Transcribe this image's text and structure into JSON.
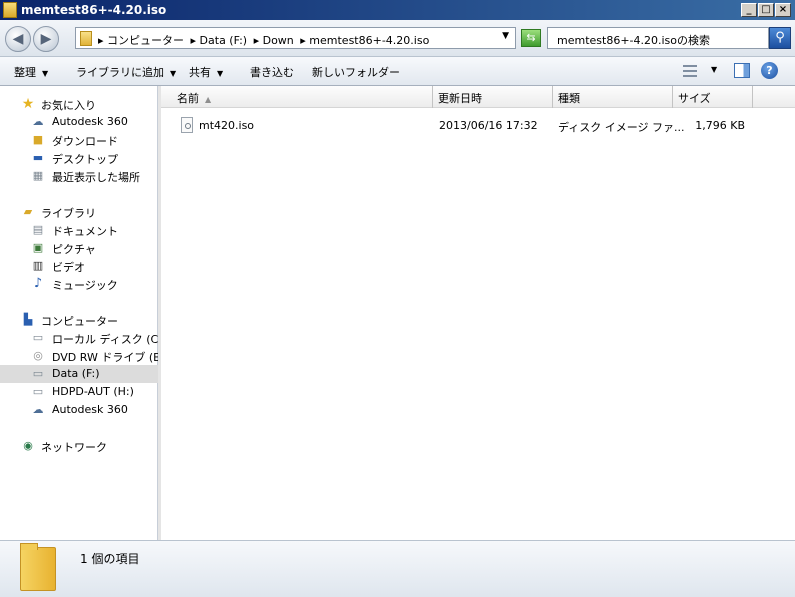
{
  "window": {
    "title": "memtest86+-4.20.iso",
    "minimize": "_",
    "maximize": "□",
    "close": "×"
  },
  "address": {
    "crumbs": [
      "▸ コンピューター",
      "▸ Data (F:)",
      "▸ Down",
      "▸ memtest86+-4.20.iso"
    ],
    "dropdown": "▼",
    "refresh": "⇆",
    "back": "◀",
    "forward": "▶"
  },
  "search": {
    "placeholder": "memtest86+-4.20.isoの検索",
    "button": "⚲"
  },
  "toolbar": {
    "organize": "整理",
    "add_to_library": "ライブラリに追加",
    "share": "共有",
    "burn": "書き込む",
    "new_folder": "新しいフォルダー",
    "arrow": "▼",
    "help": "?"
  },
  "nav": {
    "favorites": {
      "header": "お気に入り",
      "items": [
        "Autodesk 360",
        "ダウンロード",
        "デスクトップ",
        "最近表示した場所"
      ]
    },
    "libraries": {
      "header": "ライブラリ",
      "items": [
        "ドキュメント",
        "ピクチャ",
        "ビデオ",
        "ミュージック"
      ]
    },
    "computer": {
      "header": "コンピューター",
      "items": [
        "ローカル ディスク (C:)",
        "DVD RW ドライブ (E:)",
        "Data (F:)",
        "HDPD-AUT (H:)",
        "Autodesk 360"
      ]
    },
    "network": {
      "header": "ネットワーク"
    }
  },
  "columns": {
    "name": "名前",
    "date": "更新日時",
    "type": "種類",
    "size": "サイズ",
    "sort_indicator": "▲"
  },
  "files": [
    {
      "name": "mt420.iso",
      "date": "2013/06/16 17:32",
      "type": "ディスク イメージ ファ...",
      "size": "1,796 KB"
    }
  ],
  "status": {
    "count": "1 個の項目"
  }
}
